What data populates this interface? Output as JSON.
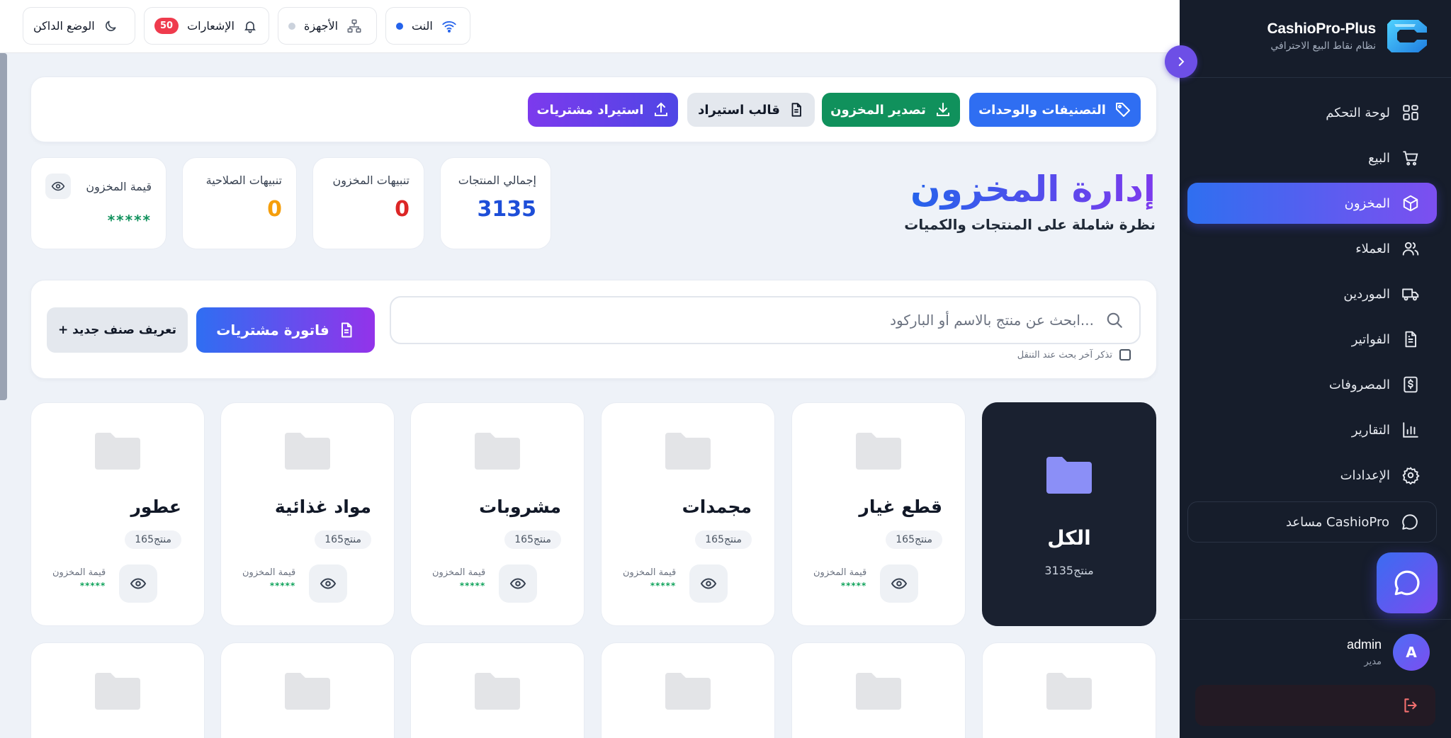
{
  "app": {
    "name": "CashioPro-Plus",
    "tagline": "نظام نقاط البيع الاحترافي"
  },
  "sidebar": {
    "items": [
      {
        "label": "لوحة التحكم",
        "icon": "dashboard-icon"
      },
      {
        "label": "البيع",
        "icon": "cart-icon"
      },
      {
        "label": "المخزون",
        "icon": "box-icon",
        "active": true
      },
      {
        "label": "العملاء",
        "icon": "users-icon"
      },
      {
        "label": "الموردين",
        "icon": "truck-icon"
      },
      {
        "label": "الفواتير",
        "icon": "invoice-icon"
      },
      {
        "label": "المصروفات",
        "icon": "money-icon"
      },
      {
        "label": "التقارير",
        "icon": "chart-icon"
      },
      {
        "label": "الإعدادات",
        "icon": "gear-icon"
      },
      {
        "label": "مساعد CashioPro",
        "icon": "chat-icon"
      }
    ],
    "user": {
      "name": "admin",
      "role": "مدير",
      "initial": "A"
    }
  },
  "topbar": {
    "dark_mode": "الوضع الداكن",
    "notifications": "الإشعارات",
    "notifications_count": "50",
    "devices": "الأجهزة",
    "network": "النت"
  },
  "actions": {
    "categories_units": "التصنيفات والوحدات",
    "export_inventory": "تصدير المخزون",
    "import_template": "قالب استيراد",
    "import_purchases": "استيراد مشتريات"
  },
  "header": {
    "title": "إدارة المخزون",
    "subtitle": "نظرة شاملة على المنتجات والكميات"
  },
  "stats": {
    "total_products_label": "إجمالي المنتجات",
    "total_products": "3135",
    "stock_alerts_label": "تنبيهات المخزون",
    "stock_alerts": "0",
    "expiry_alerts_label": "تنبيهات الصلاحية",
    "expiry_alerts": "0",
    "stock_value_label": "قيمة المخزون",
    "stock_value": "*****"
  },
  "search": {
    "placeholder": "ابحث عن منتج بالاسم أو الباركود...",
    "remember_label": "تذكر آخر بحث عند التنقل",
    "purchase_invoice": "فاتورة مشتريات",
    "new_item": "+ تعريف صنف جديد"
  },
  "categories": [
    {
      "name": "الكل",
      "count": "3135منتج"
    },
    {
      "name": "قطع غيار",
      "count": "165منتج",
      "value_label": "قيمة المخزون",
      "value": "*****"
    },
    {
      "name": "مجمدات",
      "count": "165منتج",
      "value_label": "قيمة المخزون",
      "value": "*****"
    },
    {
      "name": "مشروبات",
      "count": "165منتج",
      "value_label": "قيمة المخزون",
      "value": "*****"
    },
    {
      "name": "مواد غذائية",
      "count": "165منتج",
      "value_label": "قيمة المخزون",
      "value": "*****"
    },
    {
      "name": "عطور",
      "count": "165منتج",
      "value_label": "قيمة المخزون",
      "value": "*****"
    }
  ],
  "colors": {
    "accent_blue": "#2563eb",
    "accent_purple": "#7c3aed",
    "green": "#10915c",
    "sidebar_bg": "#161d2b"
  }
}
